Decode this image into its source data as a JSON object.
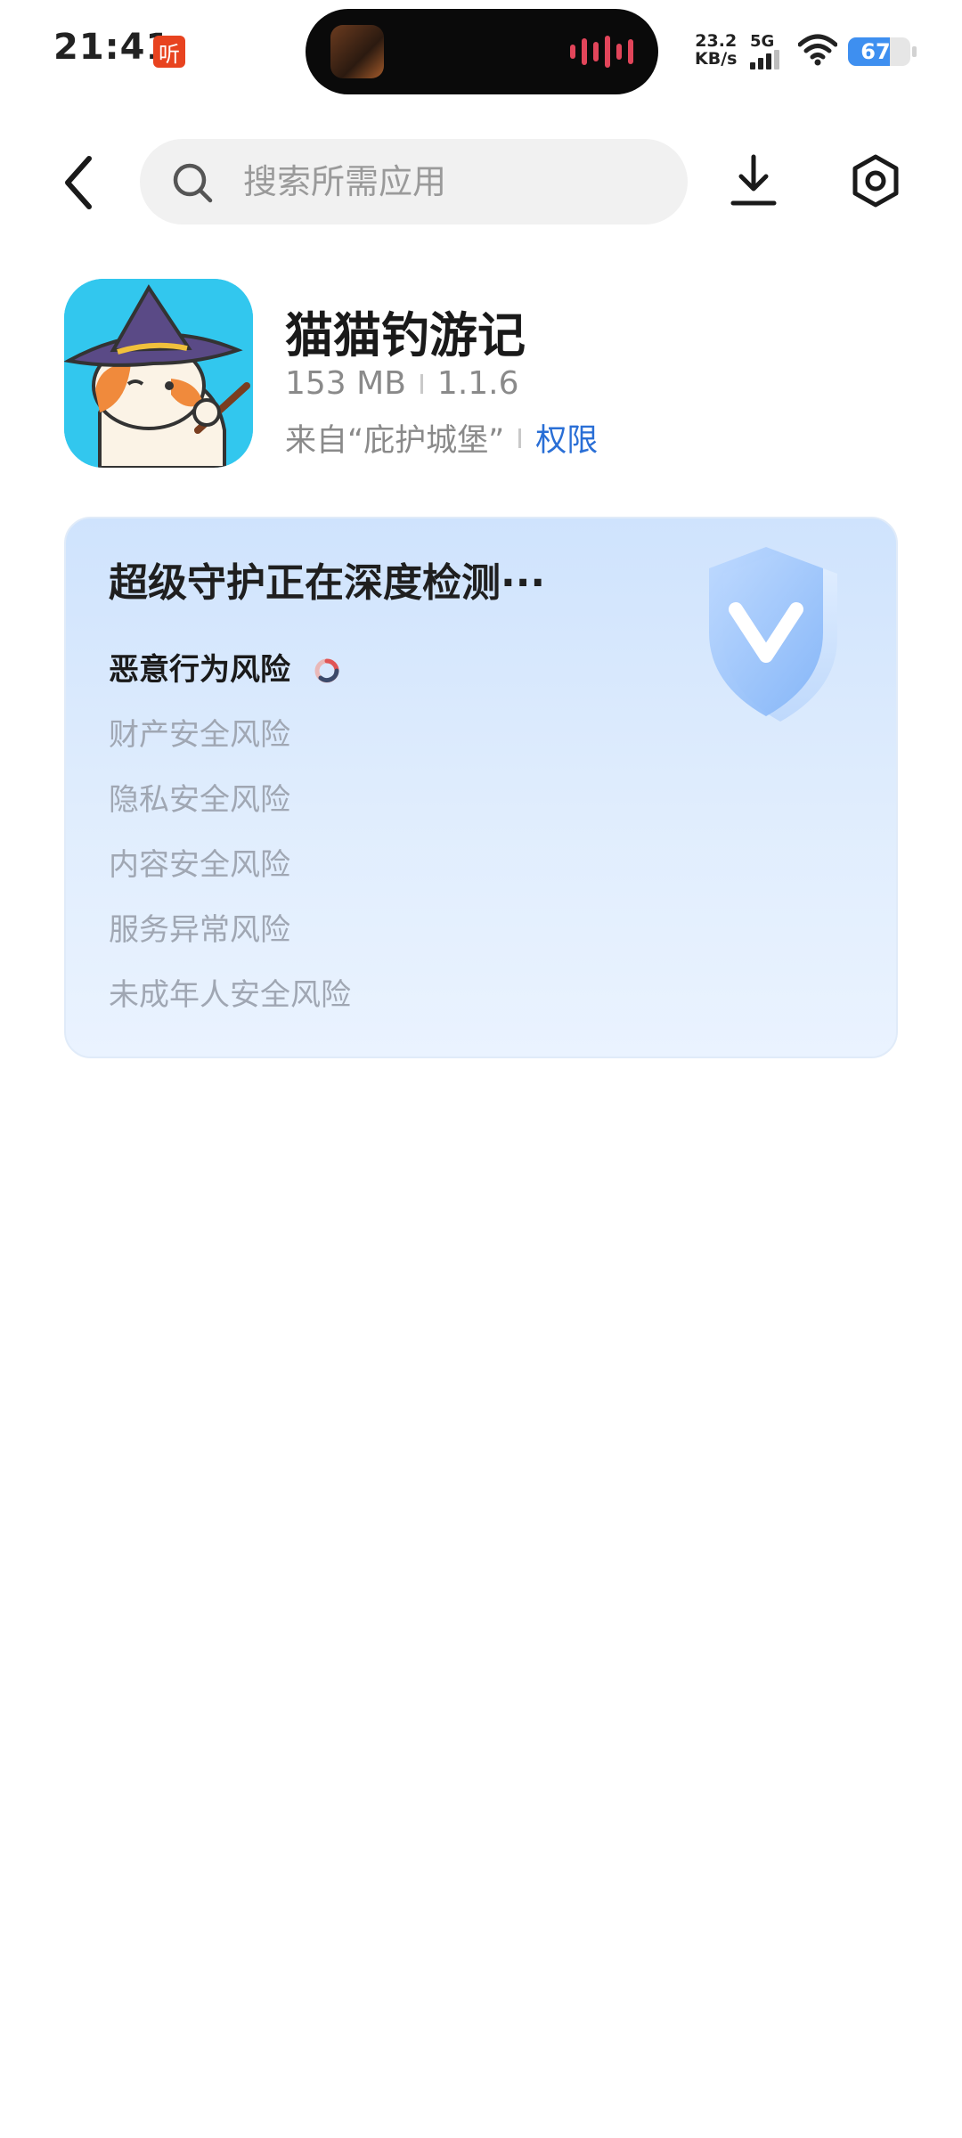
{
  "status_bar": {
    "time": "21:41",
    "app_badge": "听",
    "net_speed_value": "23.2",
    "net_speed_unit": "KB/s",
    "network_type": "5G",
    "battery_level": "67",
    "battery_fraction": 0.67,
    "icons": [
      "listen-app-icon",
      "signal-icon",
      "wifi-icon",
      "battery-icon"
    ]
  },
  "header": {
    "search_placeholder": "搜索所需应用",
    "icons": [
      "back-icon",
      "search-icon",
      "download-icon",
      "settings-icon"
    ]
  },
  "app": {
    "name": "猫猫钓游记",
    "size": "153 MB",
    "version": "1.1.6",
    "source": "来自“庇护城堡”",
    "permissions_link": "权限"
  },
  "guard": {
    "title": "超级守护正在深度检测···",
    "risks": [
      {
        "label": "恶意行为风险",
        "state": "checking"
      },
      {
        "label": "财产安全风险",
        "state": "pending"
      },
      {
        "label": "隐私安全风险",
        "state": "pending"
      },
      {
        "label": "内容安全风险",
        "state": "pending"
      },
      {
        "label": "服务异常风险",
        "state": "pending"
      },
      {
        "label": "未成年人安全风险",
        "state": "pending"
      }
    ]
  },
  "colors": {
    "accent_link": "#2a6fd6",
    "card_bg_top": "#cfe3fd",
    "card_bg_bottom": "#eaf3ff",
    "pending_text": "#a0a7b3",
    "battery_fill": "#3e8ff0",
    "badge_red": "#e8431f"
  }
}
